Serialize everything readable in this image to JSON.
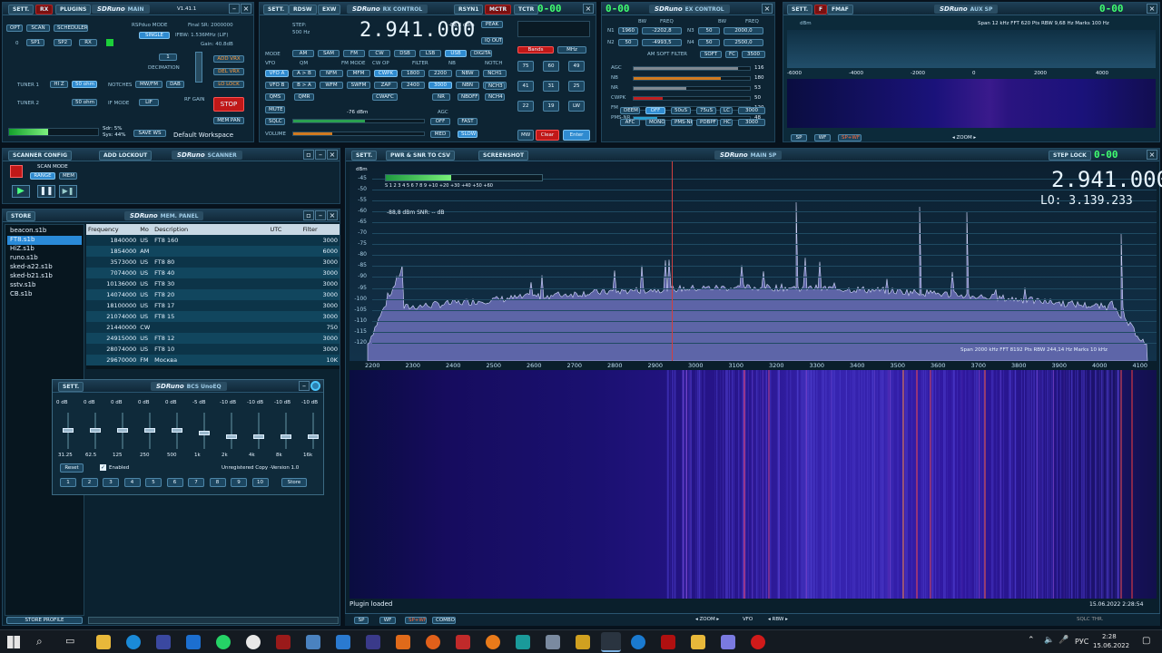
{
  "main": {
    "title": "SDRuno",
    "sub": "MAIN",
    "version": "V1.41.1",
    "tabs": [
      "SETT.",
      "RX",
      "PLUGINS"
    ],
    "mode_label": "RSPduo MODE",
    "mode": "SINGLE",
    "final_sr": "Final SR: 2000000",
    "ifbw": "IFBW: 1.536MHz (LIF)",
    "gain": "Gain: 40.8dB",
    "tuner1": "TUNER 1",
    "tuner2": "TUNER 2",
    "hiz": "HI Z",
    "ohm1": "50 ohm",
    "ohm2": "50 ohm",
    "notches": "NOTCHES",
    "mwfm": "MW/FM",
    "dab": "DAB",
    "if_mode": "IF MODE",
    "lif": "LIF",
    "decimation": "DECIMATION",
    "dec_val": "1",
    "rf_gain": "RF GAIN",
    "add_vrx": "ADD VRX",
    "del_vrx": "DEL VRX",
    "lo_lock": "LO LOCK",
    "stop": "STOP",
    "mem_pan": "MEM PAN",
    "opt": "OPT",
    "scan": "SCAN",
    "scheduler": "SCHEDULER",
    "sp1": "SP1",
    "sp2": "SP2",
    "rx": "RX",
    "save_ws": "SAVE WS",
    "workspace": "Default Workspace",
    "sdr": "Sdr: 5%",
    "sys": "Sys: 44%"
  },
  "rxctl": {
    "title": "SDRuno",
    "sub": "RX CONTROL",
    "tabs": [
      "SETT.",
      "RDSW",
      "EXW"
    ],
    "rsyn": "RSYN1",
    "mctr": "MCTR",
    "tctr": "TCTR",
    "freq": "2.941.000",
    "step_label": "STEP:",
    "step": "500 Hz",
    "dbm": "-88,8 dBm",
    "peak": "PEAK",
    "iq_out": "IQ OUT",
    "mode_label": "MODE",
    "modes": [
      "AM",
      "SAM",
      "FM",
      "CW",
      "DSB",
      "LSB",
      "USB",
      "DIGITAL"
    ],
    "vfo_labels": [
      "VFO",
      "QM",
      "FM MODE",
      "CW OP",
      "FILTER",
      "NB",
      "NOTCH"
    ],
    "vfo_btns": [
      "VFO A",
      "A > B",
      "NFM",
      "MFM",
      "CWPK",
      "1800",
      "2200",
      "NBW",
      "NCH1"
    ],
    "vfo_b": [
      "VFO B",
      "B > A",
      "WFM",
      "SWFM",
      "ZAP",
      "2400",
      "3000",
      "NBN",
      "NCH2"
    ],
    "qms": "QMS",
    "qmr": "QMR",
    "cwafc": "CWAFC",
    "nr": "NR",
    "nboff": "NBOFF",
    "nch3": "NCH3",
    "nch4": "NCH4",
    "mute": "MUTE",
    "sqlc": "SQLC",
    "agc_label": "AGC",
    "off": "OFF",
    "fast": "FAST",
    "med": "MED",
    "slow": "SLOW",
    "volume": "VOLUME",
    "sq_dbm": "-76 dBm",
    "bands": "Bands",
    "mhz": "MHz",
    "keypad": [
      "75",
      "60",
      "49",
      "41",
      "31",
      "25",
      "22",
      "19",
      "LW",
      "MW"
    ],
    "clear": "Clear",
    "enter": "Enter"
  },
  "rxclock": {
    "time": "0-00"
  },
  "excontrol": {
    "title": "SDRuno",
    "sub": "EX CONTROL",
    "headers": [
      "BW",
      "FREQ",
      "BW",
      "FREQ"
    ],
    "n1": "N1",
    "n2": "N2",
    "n3": "N3",
    "n4": "N4",
    "n1_bw": "1960",
    "n1_freq": "-2202,8",
    "n2_bw": "50",
    "n2_freq": "-4993,5",
    "n3_bw": "50",
    "n3_freq": "2000,0",
    "n4_bw": "50",
    "n4_freq": "2500,0",
    "am_soft": "AM SOFT FILTER",
    "soft": "SOFT",
    "fc": "FC",
    "fc_val": "3500",
    "agc": "AGC",
    "nb": "NB",
    "nr": "NR",
    "cwpk": "CWPK",
    "fm": "FM",
    "pms_nr": "PMS-NR",
    "agc_v": "116",
    "nb_v": "180",
    "nr_v": "53",
    "cwpk_v": "50",
    "fm_v": "120",
    "pms_v": "48",
    "deem": "DEEM",
    "off": "OFF",
    "us50": "50uS",
    "us75": "75uS",
    "lc": "LC",
    "afc": "AFC",
    "mono": "MONO",
    "pmsnr": "PMS-NR",
    "pdbpf": "PDBPF",
    "hc": "HC",
    "hc_val": "3000"
  },
  "auxsp": {
    "title": "SDRuno",
    "sub": "AUX SP",
    "tabs": [
      "SETT.",
      "F",
      "FMAF"
    ],
    "info": "Span 12 kHz  FFT 620 Pts  RBW 9,68 Hz  Marks 100 Hz",
    "dbm": "dBm",
    "ticks": [
      "-6000",
      "-4000",
      "-2000",
      "0",
      "2000",
      "4000"
    ],
    "sp": "SP",
    "wf": "WF",
    "spwf": "SP+WF",
    "zoom": "ZOOM"
  },
  "scanner": {
    "title": "SDRuno",
    "sub": "SCANNER",
    "config": "SCANNER CONFIG",
    "lockout": "ADD LOCKOUT",
    "scan_mode": "SCAN MODE",
    "range": "RANGE",
    "mem": "MEM"
  },
  "mempanel": {
    "title": "SDRuno",
    "sub": "MEM. PANEL",
    "store": "STORE",
    "files": [
      "beacon.s1b",
      "FT8.s1b",
      "HiZ.s1b",
      "runo.s1b",
      "sked-a22.s1b",
      "sked-b21.s1b",
      "sstv.s1b",
      "CB.s1b"
    ],
    "selected_file": "FT8.s1b",
    "cols": [
      "Frequency",
      "Mo",
      "Description",
      "UTC",
      "Filter"
    ],
    "rows": [
      [
        "1840000",
        "US",
        "FT8 160",
        "",
        "3000"
      ],
      [
        "1854000",
        "AM",
        "",
        "",
        "6000"
      ],
      [
        "3573000",
        "US",
        "FT8 80",
        "",
        "3000"
      ],
      [
        "7074000",
        "US",
        "FT8 40",
        "",
        "3000"
      ],
      [
        "10136000",
        "US",
        "FT8 30",
        "",
        "3000"
      ],
      [
        "14074000",
        "US",
        "FT8 20",
        "",
        "3000"
      ],
      [
        "18100000",
        "US",
        "FT8 17",
        "",
        "3000"
      ],
      [
        "21074000",
        "US",
        "FT8 15",
        "",
        "3000"
      ],
      [
        "21440000",
        "CW",
        "",
        "",
        "750"
      ],
      [
        "24915000",
        "US",
        "FT8 12",
        "",
        "3000"
      ],
      [
        "28074000",
        "US",
        "FT8 10",
        "",
        "3000"
      ],
      [
        "29670000",
        "FM",
        "Москва",
        "",
        "10K"
      ]
    ],
    "store_profile": "STORE PROFILE"
  },
  "eq": {
    "title": "SDRuno",
    "sub": "BCS UnoEQ",
    "sett": "SETT.",
    "gains": [
      "0 dB",
      "0 dB",
      "0 dB",
      "0 dB",
      "0 dB",
      "-5 dB",
      "-10 dB",
      "-10 dB",
      "-10 dB",
      "-10 dB"
    ],
    "freqs": [
      "31.25",
      "62.5",
      "125",
      "250",
      "500",
      "1k",
      "2k",
      "4k",
      "8k",
      "16k"
    ],
    "levels": [
      0.5,
      0.5,
      0.5,
      0.5,
      0.5,
      0.42,
      0.33,
      0.33,
      0.33,
      0.33
    ],
    "reset": "Reset",
    "enabled": "Enabled",
    "unreg": "Unregistered Copy -Version 1.0",
    "presets": [
      "1",
      "2",
      "3",
      "4",
      "5",
      "6",
      "7",
      "8",
      "9",
      "10"
    ],
    "store": "Store"
  },
  "mainsp": {
    "title": "SDRuno",
    "sub": "MAIN SP",
    "sett": "SETT.",
    "pwr": "PWR & SNR TO CSV",
    "screenshot": "SCREENSHOT",
    "step_lock": "STEP LOCK",
    "freq": "2.941.000",
    "lo": "LO:  3.139.233",
    "dbm_label": "dBm",
    "readout": "-88,8 dBm   SNR: -- dB",
    "smeter": "S  1  2  3  4  5  6  7  8  9  +10  +20  +30  +40  +50  +60",
    "ylabels": [
      "-40",
      "-45",
      "-50",
      "-55",
      "-60",
      "-65",
      "-70",
      "-75",
      "-80",
      "-85",
      "-90",
      "-95",
      "-100",
      "-105",
      "-110",
      "-115",
      "-120"
    ],
    "xlabels": [
      "2200",
      "2300",
      "2400",
      "2500",
      "2600",
      "2700",
      "2800",
      "2900",
      "3000",
      "3100",
      "3200",
      "3300",
      "3400",
      "3500",
      "3600",
      "3700",
      "3800",
      "3900",
      "4000",
      "4100"
    ],
    "span_info": "Span 2000 kHz  FFT 8192 Pts  RBW 244,14 Hz  Marks 10 kHz",
    "plugin_status": "Plugin loaded",
    "timestamp": "15.06.2022 2:28:54",
    "bottom": [
      "SP",
      "WF",
      "SP+WF",
      "COMBO",
      "ZOOM",
      "VFO",
      "RBW",
      "SQLC THR."
    ]
  },
  "taskbar": {
    "lang": "РУС",
    "time": "2:28",
    "date": "15.06.2022"
  }
}
